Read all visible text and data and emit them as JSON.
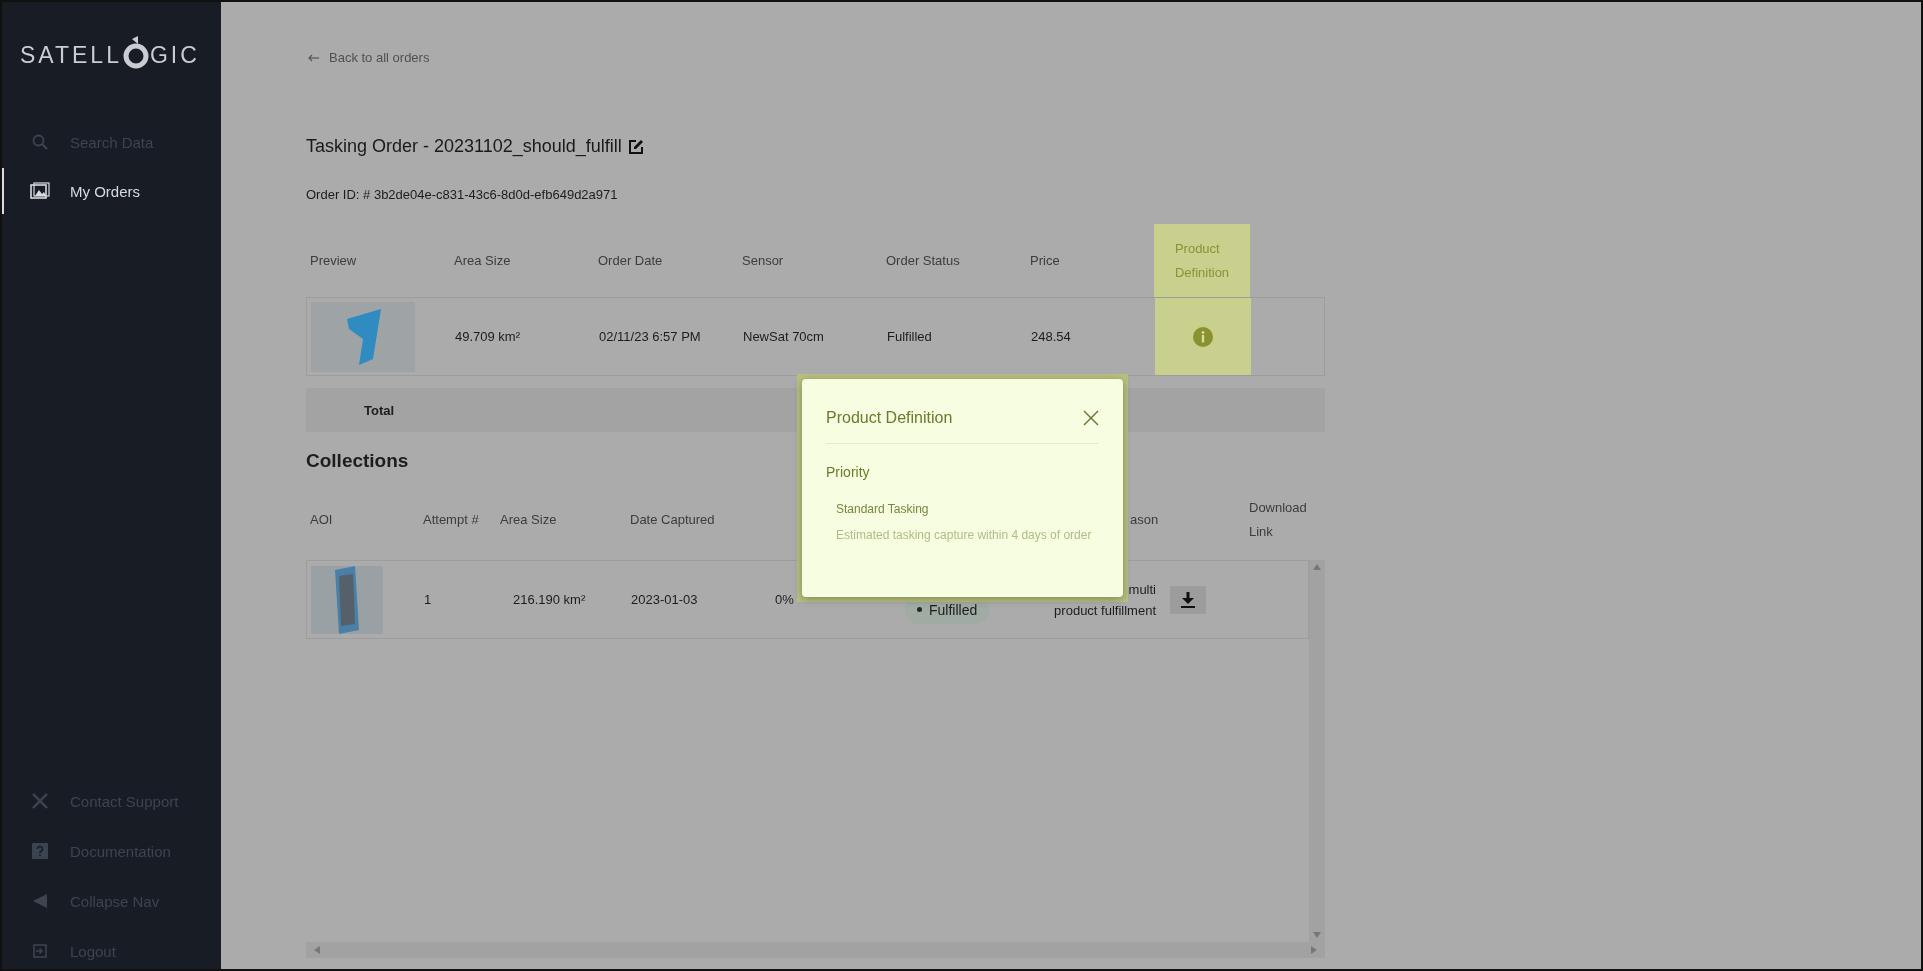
{
  "sidebar": {
    "logo": {
      "left": "SATELL",
      "right": "GIC"
    },
    "top_items": [
      {
        "label": "Search Data",
        "selected": false
      },
      {
        "label": "My Orders",
        "selected": true
      }
    ],
    "bottom_items": [
      {
        "label": "Contact Support"
      },
      {
        "label": "Documentation"
      },
      {
        "label": "Collapse Nav"
      },
      {
        "label": "Logout"
      }
    ]
  },
  "back_link": "Back to all orders",
  "title": "Tasking Order - 20231102_should_fulfill",
  "order_id": "Order ID: # 3b2de04e-c831-43c6-8d0d-efb649d2a971",
  "order_table": {
    "columns": [
      {
        "label": "Preview",
        "highlighted": false
      },
      {
        "label": "Area Size",
        "highlighted": false
      },
      {
        "label": "Order Date",
        "highlighted": false
      },
      {
        "label": "Sensor",
        "highlighted": false
      },
      {
        "label": "Order Status",
        "highlighted": false
      },
      {
        "label": "Price",
        "highlighted": false
      },
      {
        "label": "Product Definition",
        "highlighted": true
      }
    ],
    "row": {
      "area_size": "49.709 km²",
      "order_date": "02/11/23 6:57 PM",
      "sensor": "NewSat 70cm",
      "order_status": "Fulfilled",
      "price": "248.54"
    },
    "total_label": "Total"
  },
  "collections": {
    "heading": "Collections",
    "columns": [
      "AOI",
      "Attempt #",
      "Area Size",
      "Date Captured",
      "ason",
      "Download Link"
    ],
    "row": {
      "attempt": "1",
      "area_size": "216.190 km²",
      "date_captured": "2023-01-03",
      "column_5": "0%",
      "status": "Fulfilled",
      "reason": [
        "multi",
        "product fulfillment"
      ]
    }
  },
  "modal": {
    "title": "Product Definition",
    "section": "Priority",
    "option_title": "Standard Tasking",
    "option_description": "Estimated tasking capture within 4 days of order"
  }
}
